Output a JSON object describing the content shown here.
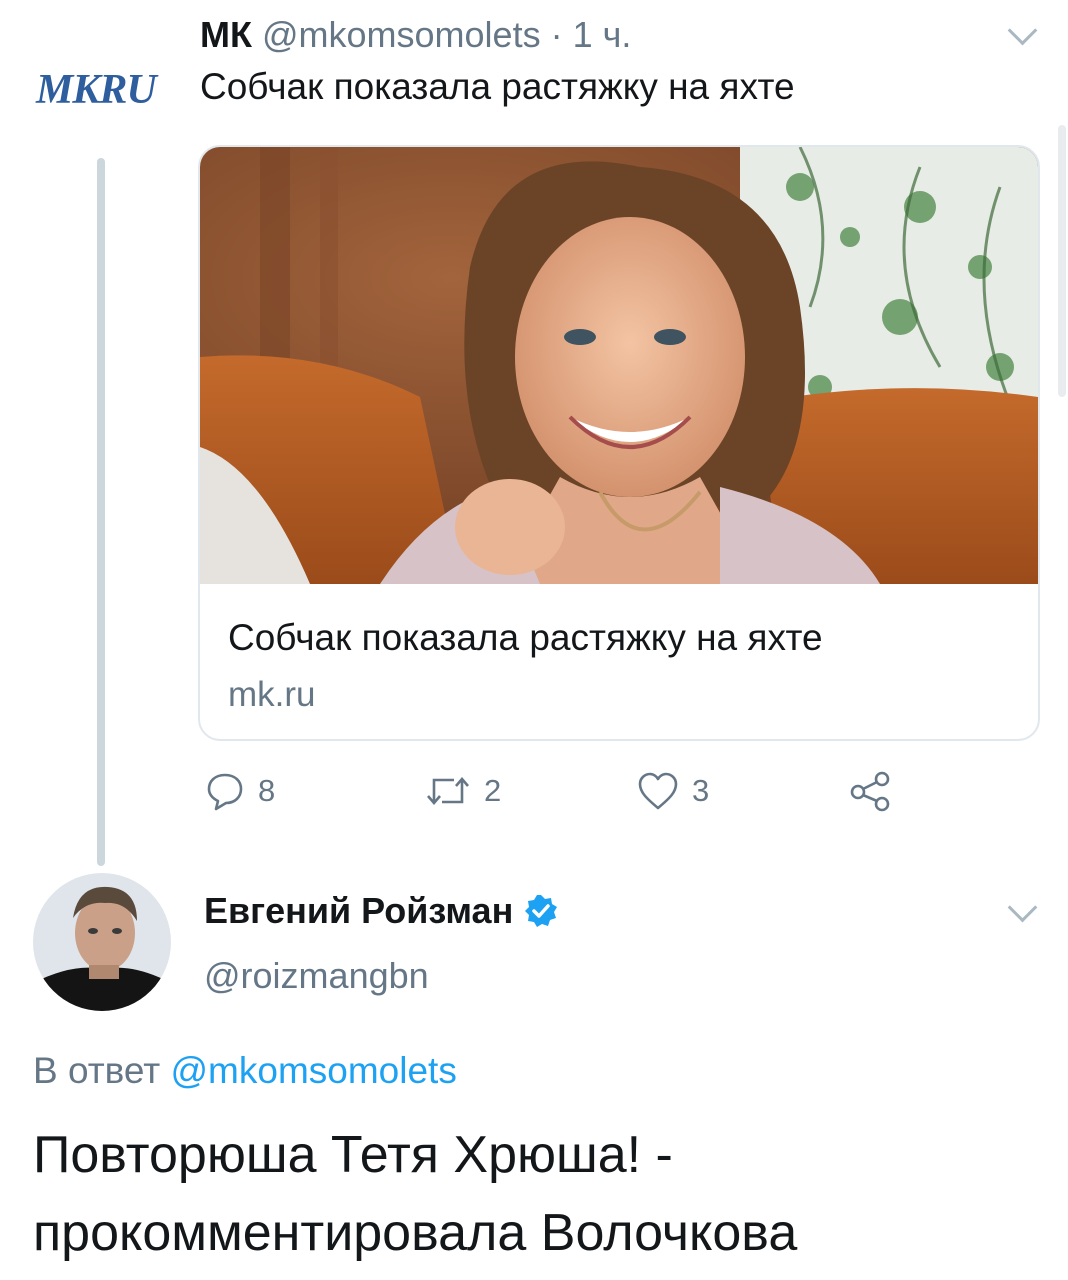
{
  "tweet1": {
    "logo": "MKRU",
    "name": "МК",
    "handle": "@mkomsomolets",
    "time": "· 1 ч.",
    "text": "Собчак показала растяжку на яхте",
    "card": {
      "title": "Собчак показала растяжку на яхте",
      "domain": "mk.ru"
    },
    "actions": {
      "replies": "8",
      "retweets": "2",
      "likes": "3"
    }
  },
  "tweet2": {
    "name": "Евгений Ройзман",
    "handle": "@roizmangbn",
    "reply_prefix": "В ответ",
    "reply_to": "@mkomsomolets",
    "text": "Повторюша Тетя Хрюша! - прокомментировала Волочкова"
  },
  "colors": {
    "text": "#14171a",
    "muted": "#657786",
    "link": "#1da1f2",
    "border": "#e1e8ed",
    "verified": "#1da1f2"
  }
}
